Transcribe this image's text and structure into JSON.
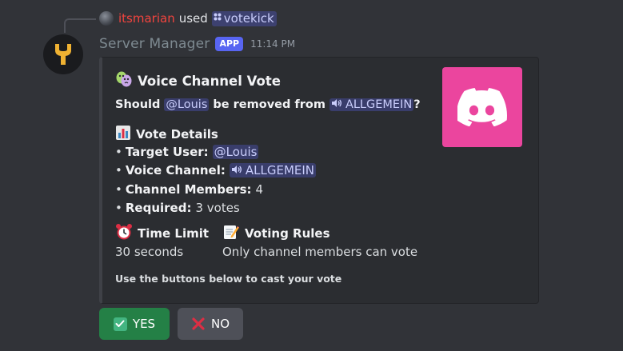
{
  "reply": {
    "username": "itsmarian",
    "used_text": "used",
    "command": "votekick"
  },
  "message": {
    "author": "Server Manager",
    "badge": "APP",
    "timestamp": "11:14 PM"
  },
  "embed": {
    "title": "Voice Channel Vote",
    "question_prefix": "Should",
    "question_user": "@Louis",
    "question_middle": "be removed from",
    "question_channel": "ALLGEMEIN",
    "question_suffix": "?",
    "details_title": "Vote Details",
    "details": [
      {
        "label": "Target User:",
        "value": "@Louis",
        "type": "user"
      },
      {
        "label": "Voice Channel:",
        "value": "ALLGEMEIN",
        "type": "channel"
      },
      {
        "label": "Channel Members:",
        "value": "4",
        "type": "text"
      },
      {
        "label": "Required:",
        "value": "3 votes",
        "type": "text"
      }
    ],
    "fields": [
      {
        "name": "Time Limit",
        "value": "30 seconds",
        "icon": "alarm-clock-icon"
      },
      {
        "name": "Voting Rules",
        "value": "Only channel members can vote",
        "icon": "memo-icon"
      }
    ],
    "footer_note": "Use the buttons below to cast your vote",
    "thumbnail_color": "#eb459e"
  },
  "buttons": {
    "yes_label": "YES",
    "no_label": "NO"
  },
  "colors": {
    "background": "#313338",
    "embed_bg": "#2b2d31",
    "blurple": "#5865f2",
    "success": "#248046",
    "secondary": "#4e5058",
    "reply_user": "#f2443e"
  }
}
